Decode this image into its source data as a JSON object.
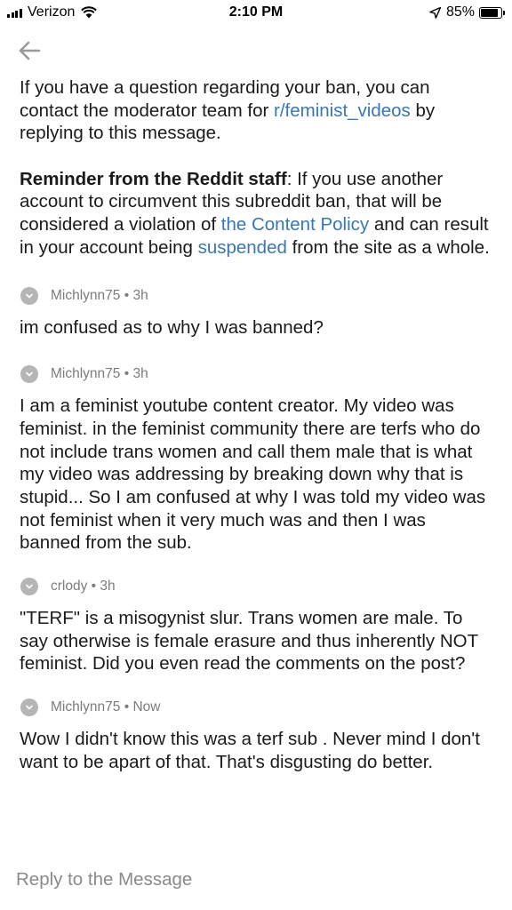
{
  "status_bar": {
    "carrier": "Verizon",
    "time": "2:10 PM",
    "battery": "85%",
    "battery_level": 0.85
  },
  "notice": {
    "text_before_link": "If you have a question regarding your ban, you can contact the moderator team for ",
    "subreddit_link": "r/feminist_videos",
    "text_after_link": " by replying to this message."
  },
  "reminder": {
    "bold_label": "Reminder from the Reddit staff",
    "text_1": ": If you use another account to circumvent this subreddit ban, that will be considered a violation of ",
    "content_policy_link": "the Content Policy",
    "text_2": " and can result in your account being ",
    "suspended_link": "suspended",
    "text_3": " from the site as a whole."
  },
  "messages": [
    {
      "author": "Michlynn75",
      "time": "3h",
      "body": "im confused as to why I was banned?"
    },
    {
      "author": "Michlynn75",
      "time": "3h",
      "body": "I am a feminist youtube content creator. My video was feminist. in the feminist community there are terfs who do not include trans women and call them male that is what my video was addressing by breaking down why that is stupid... So I am confused at why I was told my video was not feminist when it very much was and then I was banned from the sub."
    },
    {
      "author": "crlody",
      "time": "3h",
      "body": "\"TERF\" is a misogynist slur. Trans women are male. To say otherwise is female erasure and thus inherently NOT feminist. Did you even read the comments on the post?"
    },
    {
      "author": "Michlynn75",
      "time": "Now",
      "body": "Wow I didn't know this was a terf sub . Never mind I don't want to be apart of that. That's disgusting do better."
    }
  ],
  "separator": " • ",
  "reply_label": "Reply to the Message",
  "colors": {
    "link": "#3a76b5",
    "meta": "#7c7c7c",
    "avatar": "#b5b5b5",
    "text": "#1a1a1b"
  },
  "icons": {
    "back": "arrow-left-icon",
    "avatar": "chevron-down-icon",
    "wifi": "wifi-icon",
    "location": "location-arrow-icon",
    "battery": "battery-icon"
  }
}
